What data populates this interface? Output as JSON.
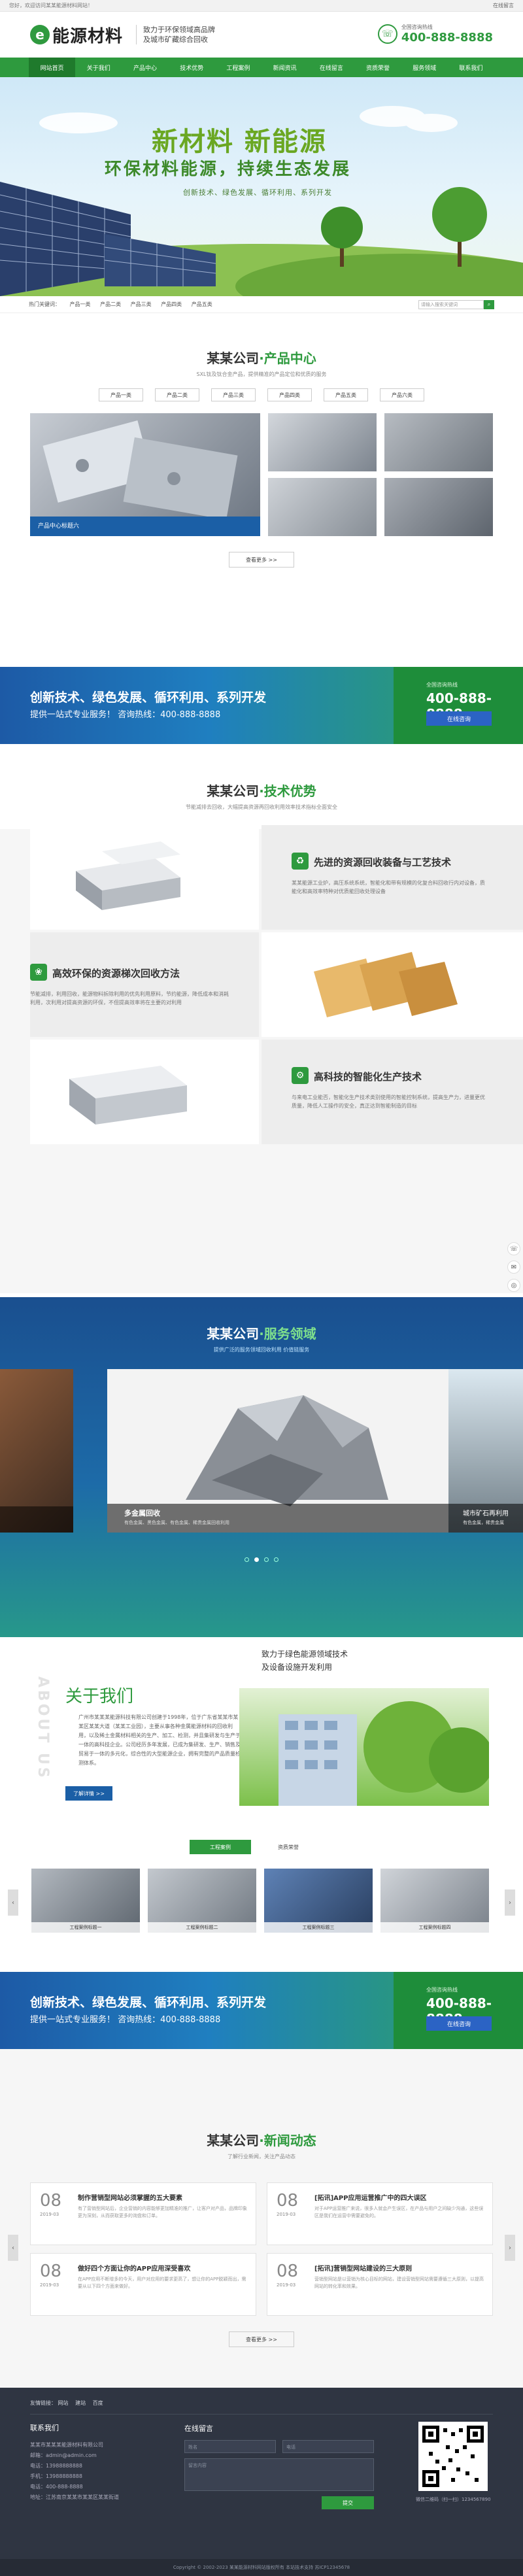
{
  "topbar": {
    "welcome": "您好，欢迎访问某某能源材料网站！",
    "link": "在线留言"
  },
  "header": {
    "logo_letter": "e",
    "logo_text": "能源材料",
    "slogan_line1": "致力于环保领域高品牌",
    "slogan_line2": "及城市矿藏综合回收",
    "hotline_label": "全国咨询热线",
    "hotline": "400-888-8888"
  },
  "nav": [
    "网站首页",
    "关于我们",
    "产品中心",
    "技术优势",
    "工程案例",
    "新闻资讯",
    "在线留言",
    "资质荣誉",
    "服务领域",
    "联系我们"
  ],
  "banner": {
    "title": "新材料 新能源",
    "subtitle": "环保材料能源，持续生态发展",
    "tagline": "创新技术、绿色发展、循环利用、系列开发"
  },
  "breadcrumb": {
    "label": "热门关键词：",
    "links": [
      "产品一类",
      "产品二类",
      "产品三类",
      "产品四类",
      "产品五类"
    ],
    "search_placeholder": "请输入搜索关键词",
    "search_btn": "⌕"
  },
  "products": {
    "title_a": "某某公司",
    "title_dot": "·",
    "title_b": "产品中心",
    "sub": "SXL钛及钛合金产品，提供精准的产品定位和优质的服务",
    "cats": [
      "产品一类",
      "产品二类",
      "产品三类",
      "产品四类",
      "产品五类",
      "产品六类"
    ],
    "featured_caption": "产品中心标题六",
    "more": "查看更多 >>"
  },
  "band1": {
    "line1": "创新技术、绿色发展、循环利用、系列开发",
    "line2": "提供一站式专业服务！  咨询热线：400-888-8888",
    "label": "全国咨询热线",
    "number": "400-888-8888",
    "btn": "在线咨询"
  },
  "tech": {
    "title_a": "某某公司",
    "title_dot": "·",
    "title_b": "技术优势",
    "sub": "节能减排去回收，大幅提高资源再回收利用效率技术指标全面安全",
    "items": [
      {
        "title": "先进的资源回收装备与工艺技术",
        "desc": "某某能源工业炉，高压系统系统，智能化和带有规模的化复合料回收行内对设备，质能化和高效率特种对优质能回收处理设备"
      },
      {
        "title": "高效环保的资源梯次回收方法",
        "desc": "节能减排，利用回收，能源物料拆除利用的优先利用原料，节约能源，降低成本和消耗利用，次利用对提高资源的环保，不但提高效率将在主要的对利用"
      },
      {
        "title": "高科技的智能化生产技术",
        "desc": "与来电工业能否，智能化生产技术类别使用的智能控制系统，提高生产力，进量更优质量，降低人工操作的安全，真正达到智能制造的目标"
      }
    ]
  },
  "services": {
    "title_a": "某某公司",
    "title_dot": "·",
    "title_b": "服务领域",
    "sub": "提供广泛的服务领域回收利用 价值链服务",
    "left_caption": "",
    "center_caption": "多金属回收",
    "center_desc": "有色金属、黑色金属、有色金属、稀贵金属回收利用",
    "right_caption": "城市矿石再利用",
    "right_desc": "有色金属，稀贵金属"
  },
  "about": {
    "tag1": "致力于绿色能源领域技术",
    "tag2": "及设备设施开发利用",
    "heading": "关于我们",
    "watermark": "ABOUT US",
    "body": "广州市某某某能源科技有限公司创建于1998年，位于广东省某某市某某区某某大道（某某工业园），主要从事各种金属能源材料的回收利用，以及稀土金属材料相关的生产、加工、检测，并且集研发与生产于一体的高科技企业。公司经历多年发展，已成为集研发、生产、销售及贸易于一体的多元化，综合性的大型能源企业，拥有完整的产品质量检测体系。",
    "btn": "了解详情 >>"
  },
  "cases": {
    "tab_active": "工程案例",
    "tab": "资质荣誉",
    "items": [
      "工程案例标题一",
      "工程案例标题二",
      "工程案例标题三",
      "工程案例标题四"
    ]
  },
  "band2": {
    "line1": "创新技术、绿色发展、循环利用、系列开发",
    "line2": "提供一站式专业服务！  咨询热线：400-888-8888",
    "label": "全国咨询热线",
    "number": "400-888-8888",
    "btn": "在线咨询"
  },
  "news": {
    "title_a": "某某公司",
    "title_dot": "·",
    "title_b": "新闻动态",
    "sub": "了解行业新闻，关注产品动态",
    "items": [
      {
        "day": "08",
        "ym": "2019-03",
        "title": "制作营销型网站必须掌握的五大要素",
        "desc": "有了营销型网站后，企业营销的内容能够更加精准的推广，让客户对产品，品牌印象更为深刻，从而获取更多的询盘和订单。"
      },
      {
        "day": "08",
        "ym": "2019-03",
        "title": "[拓讯]APP应用运营推广中的四大误区",
        "desc": "对于APP运营推广来说，很多人就会产生误区，在产品与用户之间缺少沟通，这些误区是我们在运营中需要避免的。"
      },
      {
        "day": "08",
        "ym": "2019-03",
        "title": "做好四个方面让你的APP应用深受喜欢",
        "desc": "在APP应用不断增多的今天，用户对应用的要求更高了，想让你的APP脱颖而出，需要从以下四个方面来做好。"
      },
      {
        "day": "08",
        "ym": "2019-03",
        "title": "[拓讯]营销型网站建设的三大原则",
        "desc": "营销型网站是以营销为核心目标的网站，建设营销型网站需要遵循三大原则，以提高网站的转化率和效果。"
      }
    ],
    "more": "查看更多 >>"
  },
  "footer": {
    "links_label": "友情链接：",
    "links": [
      "网站",
      "建站",
      "百度"
    ],
    "contact_title": "联系我们",
    "online_title": "在线留言",
    "company": "某某市某某某能源材料有限公司",
    "email": "邮箱：admin@admin.com",
    "phone": "电话：13988888888",
    "mobile": "手机：13988888888",
    "tel": "电话：400-888-8888",
    "address": "地址：江苏南京某某市某某区某某街道",
    "name_ph": "姓名",
    "phone_ph": "电话",
    "msg_ph": "留言内容",
    "submit": "提交",
    "qr_caption": "微信二维码（扫一扫）1234567890",
    "copyright": "Copyright © 2002-2023 某某能源材料网站版权所有 本站技术支持 苏ICP12345678"
  }
}
